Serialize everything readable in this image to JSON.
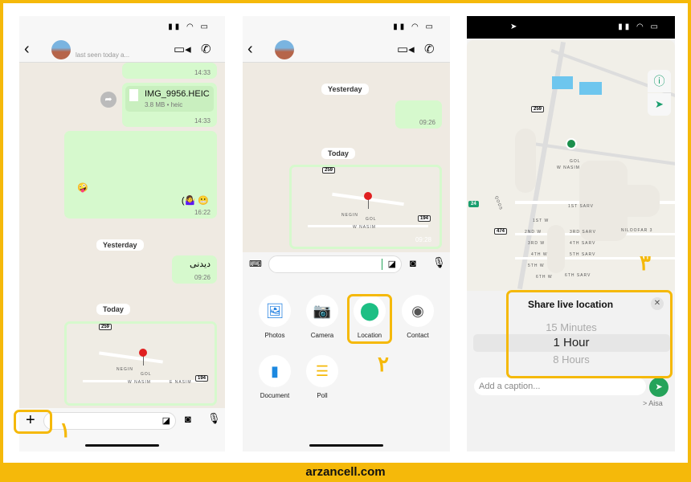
{
  "footer": {
    "site": "arzancell.com"
  },
  "colors": {
    "accent": "#f5b90a",
    "bubble": "#d6f9cd",
    "whatsapp_green": "#25a35a"
  },
  "panel1": {
    "header": {
      "last_seen": "last seen today a..."
    },
    "messages": [
      {
        "time": "14:33"
      },
      {
        "file_name": "IMG_9956.HEIC",
        "file_meta": "3.8 MB • heic",
        "time": "14:33"
      },
      {
        "emoji_left": "🤪",
        "emoji_right": "(🤷‍♀️ 😬",
        "time": "16:22"
      },
      {
        "text": "دیدنی",
        "time": "09:26"
      }
    ],
    "date_yesterday": "Yesterday",
    "date_today": "Today",
    "map": {
      "labels": [
        "NEGIN",
        "GOL",
        "W NASIM",
        "E NASIM"
      ],
      "shields": [
        "259",
        "194"
      ]
    },
    "step_number": "١"
  },
  "panel2": {
    "date_yesterday": "Yesterday",
    "bubble_time": "09:26",
    "date_today": "Today",
    "map": {
      "labels": [
        "NEGIN",
        "GOL",
        "W NASIM"
      ],
      "shields": [
        "259",
        "194"
      ],
      "time": "09:28"
    },
    "attachments": [
      {
        "label": "Photos",
        "icon": "photos-icon"
      },
      {
        "label": "Camera",
        "icon": "camera-icon"
      },
      {
        "label": "Location",
        "icon": "location-pin-icon"
      },
      {
        "label": "Contact",
        "icon": "contact-icon"
      },
      {
        "label": "Document",
        "icon": "document-icon"
      },
      {
        "label": "Poll",
        "icon": "poll-icon"
      }
    ],
    "step_number": "٢"
  },
  "panel3": {
    "map": {
      "shields": [
        "259",
        "24",
        "474"
      ],
      "labels": [
        "GOL",
        "W NASIM",
        "1ST SARV",
        "1ST W",
        "2ND W",
        "3RD SARV",
        "NILOOFAR 3",
        "3RD W",
        "4TH SARV",
        "4TH W",
        "5TH W",
        "5TH SARV",
        "6TH W",
        "6TH SARV",
        "QODS"
      ]
    },
    "share": {
      "title": "Share live location",
      "options": [
        "15 Minutes",
        "1 Hour",
        "8 Hours"
      ],
      "selected": "1 Hour"
    },
    "caption_placeholder": "Add a caption...",
    "recipient": "> Aisa",
    "step_number": "٣"
  }
}
